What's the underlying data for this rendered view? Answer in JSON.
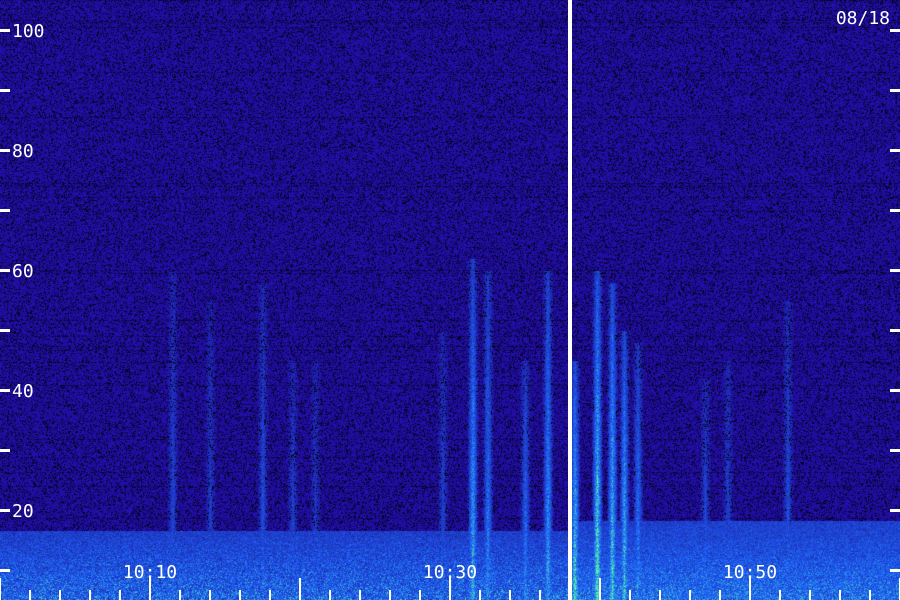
{
  "chart_data": {
    "type": "heatmap",
    "title": "",
    "xlabel": "",
    "ylabel": "",
    "date": "08/18",
    "y_ticks": [
      {
        "value": 100,
        "label": "100"
      },
      {
        "value": 90,
        "label": ""
      },
      {
        "value": 80,
        "label": "80"
      },
      {
        "value": 70,
        "label": ""
      },
      {
        "value": 60,
        "label": "60"
      },
      {
        "value": 50,
        "label": ""
      },
      {
        "value": 40,
        "label": "40"
      },
      {
        "value": 30,
        "label": ""
      },
      {
        "value": 20,
        "label": "20"
      },
      {
        "value": 10,
        "label": ""
      }
    ],
    "x_ticks": [
      {
        "label": "10:10",
        "minute": 10
      },
      {
        "label": "10:30",
        "minute": 30
      },
      {
        "label": "10:50",
        "minute": 50
      }
    ],
    "x_range_minutes": [
      0,
      60
    ],
    "y_range": [
      5,
      105
    ],
    "marker_line_minute": 38,
    "colors": {
      "background": "#1a0a5e",
      "noise_dark": "#050018",
      "noise_mid": "#3c1cb8",
      "noise_bright": "#5a3cff",
      "signal_blue": "#2f7dff",
      "signal_cyan": "#2fe0ff",
      "signal_green": "#5cff8a",
      "text": "#ffffff"
    },
    "events": [
      {
        "minute": 11.5,
        "top": 60,
        "intensity": 0.35
      },
      {
        "minute": 14,
        "top": 55,
        "intensity": 0.3
      },
      {
        "minute": 17.5,
        "top": 58,
        "intensity": 0.4
      },
      {
        "minute": 19.5,
        "top": 45,
        "intensity": 0.35
      },
      {
        "minute": 21,
        "top": 45,
        "intensity": 0.3
      },
      {
        "minute": 29.5,
        "top": 50,
        "intensity": 0.35
      },
      {
        "minute": 31.5,
        "top": 62,
        "intensity": 0.75
      },
      {
        "minute": 32.5,
        "top": 60,
        "intensity": 0.6
      },
      {
        "minute": 35,
        "top": 45,
        "intensity": 0.55
      },
      {
        "minute": 36.5,
        "top": 60,
        "intensity": 0.7
      },
      {
        "minute": 38.3,
        "top": 45,
        "intensity": 0.9
      },
      {
        "minute": 39.8,
        "top": 60,
        "intensity": 0.95
      },
      {
        "minute": 40.8,
        "top": 58,
        "intensity": 0.85
      },
      {
        "minute": 41.6,
        "top": 50,
        "intensity": 0.8
      },
      {
        "minute": 42.5,
        "top": 48,
        "intensity": 0.6
      },
      {
        "minute": 47,
        "top": 42,
        "intensity": 0.4
      },
      {
        "minute": 48.5,
        "top": 45,
        "intensity": 0.35
      },
      {
        "minute": 52.5,
        "top": 55,
        "intensity": 0.4
      }
    ]
  }
}
